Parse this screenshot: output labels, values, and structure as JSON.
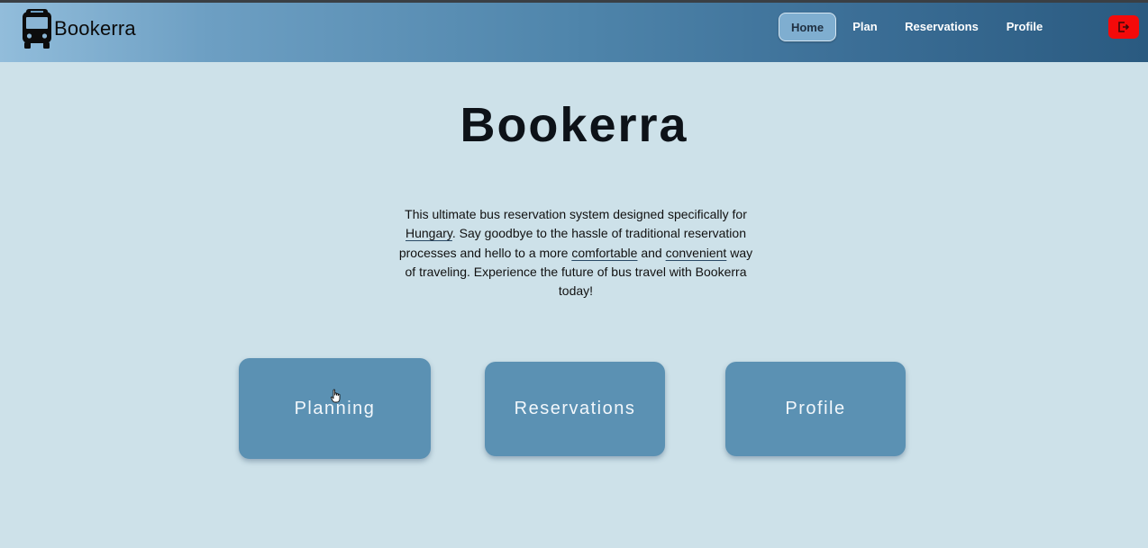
{
  "brand": {
    "name": "Bookerra",
    "icon": "bus-icon"
  },
  "nav": {
    "items": [
      {
        "label": "Home",
        "active": true
      },
      {
        "label": "Plan",
        "active": false
      },
      {
        "label": "Reservations",
        "active": false
      },
      {
        "label": "Profile",
        "active": false
      }
    ],
    "logout_icon": "logout-icon"
  },
  "hero": {
    "title": "Bookerra"
  },
  "intro": {
    "t1": "This ultimate bus reservation system designed specifically for ",
    "hungary": "Hungary",
    "t2": ". Say goodbye to the hassle of traditional reservation processes and hello to a more ",
    "comfortable": "comfortable",
    "t3": " and ",
    "convenient": "convenient",
    "t4": " way of traveling. Experience the future of bus travel with Bookerra today!"
  },
  "cards": [
    {
      "label": "Planning"
    },
    {
      "label": "Reservations"
    },
    {
      "label": "Profile"
    }
  ],
  "colors": {
    "background": "#cde1e9",
    "card": "#5b91b3",
    "logout": "#f40a0a",
    "nav_active": "#7faed0"
  }
}
